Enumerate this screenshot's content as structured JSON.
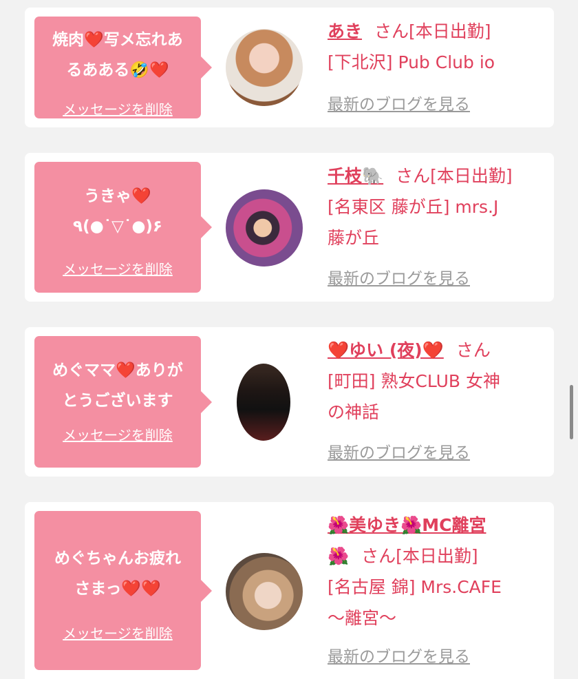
{
  "colors": {
    "page_background": "#f2f2f2",
    "card_background": "#ffffff",
    "bubble_pink": "#f48fa2",
    "name_pink": "#e0405c",
    "link_gray": "#9a9a9a"
  },
  "entries": [
    {
      "message_lines": [
        "焼肉❤️写メ忘れあ",
        "るあある🤣❤️"
      ],
      "delete_label": "メッセージを削除",
      "name": "あき",
      "name_suffix": "さん[本日出勤]",
      "shop_lines": [
        "[下北沢] Pub Club io"
      ],
      "blog_label": "最新のブログを見る"
    },
    {
      "message_lines": [
        "うきゃ❤️",
        "٩(●˙▽˙●)۶"
      ],
      "delete_label": "メッセージを削除",
      "name": "千枝🐘",
      "name_suffix": "さん[本日出勤]",
      "shop_lines": [
        "[名東区 藤が丘] mrs.J",
        "藤が丘"
      ],
      "blog_label": "最新のブログを見る"
    },
    {
      "message_lines": [
        "めぐママ❤️ありが",
        "とうございます"
      ],
      "delete_label": "メッセージを削除",
      "name": "❤️ゆい (夜)❤️",
      "name_suffix": "さん",
      "shop_lines": [
        "[町田] 熟女CLUB 女神",
        "の神話"
      ],
      "blog_label": "最新のブログを見る"
    },
    {
      "message_lines": [
        "めぐちゃんお疲れ",
        "さまっ❤️❤️"
      ],
      "delete_label": "メッセージを削除",
      "name": "🌺美ゆき🌺MC離宮",
      "name_line2_prefix": "🌺",
      "name_suffix": "さん[本日出勤]",
      "shop_lines": [
        "[名古屋 錦] Mrs.CAFE",
        "〜離宮〜"
      ],
      "blog_label": "最新のブログを見る"
    }
  ]
}
